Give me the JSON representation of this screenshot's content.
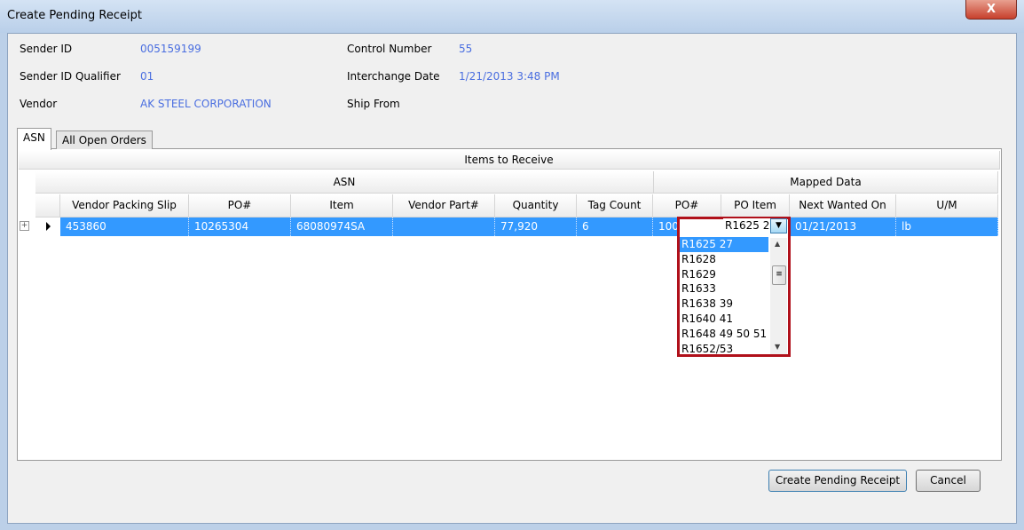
{
  "window": {
    "title": "Create Pending Receipt",
    "close_label": "X"
  },
  "info": {
    "sender_id_label": "Sender ID",
    "sender_id": "005159199",
    "sender_id_qualifier_label": "Sender ID Qualifier",
    "sender_id_qualifier": "01",
    "vendor_label": "Vendor",
    "vendor": "AK STEEL CORPORATION",
    "control_number_label": "Control Number",
    "control_number": "55",
    "interchange_date_label": "Interchange Date",
    "interchange_date": "1/21/2013 3:48 PM",
    "ship_from_label": "Ship From",
    "ship_from": ""
  },
  "tabs": [
    {
      "label": "ASN",
      "active": true
    },
    {
      "label": "All Open Orders",
      "active": false
    }
  ],
  "grid": {
    "caption": "Items to Receive",
    "groups": [
      "ASN",
      "Mapped Data"
    ],
    "columns": [
      "Vendor Packing Slip",
      "PO#",
      "Item",
      "Vendor Part#",
      "Quantity",
      "Tag Count",
      "PO#",
      "PO Item",
      "Next Wanted On",
      "U/M"
    ],
    "rows": [
      [
        "453860",
        "10265304",
        "68080974SA",
        "",
        "77,920",
        "6",
        "10042828",
        "R1625 27",
        "01/21/2013",
        "lb"
      ]
    ]
  },
  "dropdown": {
    "selected": "R1625 27",
    "options": [
      "R1625 27",
      "R1628",
      "R1629",
      "R1633",
      "R1638 39",
      "R1640 41",
      "R1648 49 50 51",
      "R1652/53"
    ]
  },
  "buttons": {
    "create": "Create Pending Receipt",
    "cancel": "Cancel"
  },
  "colors": {
    "selection": "#3399ff",
    "value_text": "#4a6ee0",
    "highlight_border": "#b0101a"
  }
}
